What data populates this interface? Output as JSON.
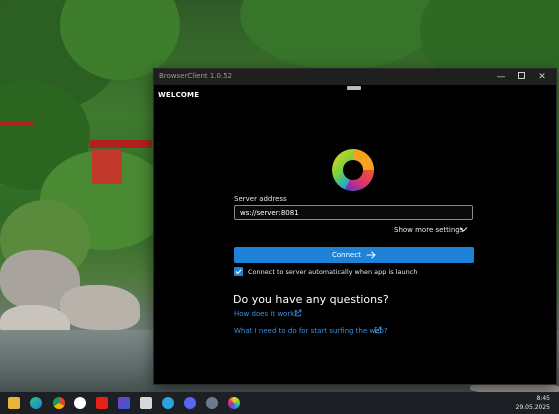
{
  "window": {
    "title": "BrowserClient 1.0.52",
    "section_title": "WELCOME"
  },
  "form": {
    "server_label": "Server address",
    "server_value": "ws://server:8081",
    "more_settings_label": "Show more settings",
    "connect_label": "Connect",
    "auto_connect_label": "Connect to server automatically when app is launch",
    "auto_connect_checked": true
  },
  "help": {
    "heading": "Do you have any questions?",
    "link1": "How does it work?",
    "link2": "What I need to do for start surfing the web?"
  },
  "taskbar": {
    "time": "8:45",
    "date": "29.05.2025",
    "icons": [
      "file-explorer-icon",
      "edge-icon",
      "chrome-icon",
      "yandex-icon",
      "youtube-icon",
      "app-icon",
      "save-icon",
      "telegram-icon",
      "discord-icon",
      "settings-icon",
      "browserclient-icon"
    ]
  },
  "colors": {
    "accent": "#1f82d9",
    "link": "#3c8fe0",
    "window_bg": "#000000",
    "titlebar": "#1f1f1f",
    "taskbar": "#1c1f24"
  }
}
